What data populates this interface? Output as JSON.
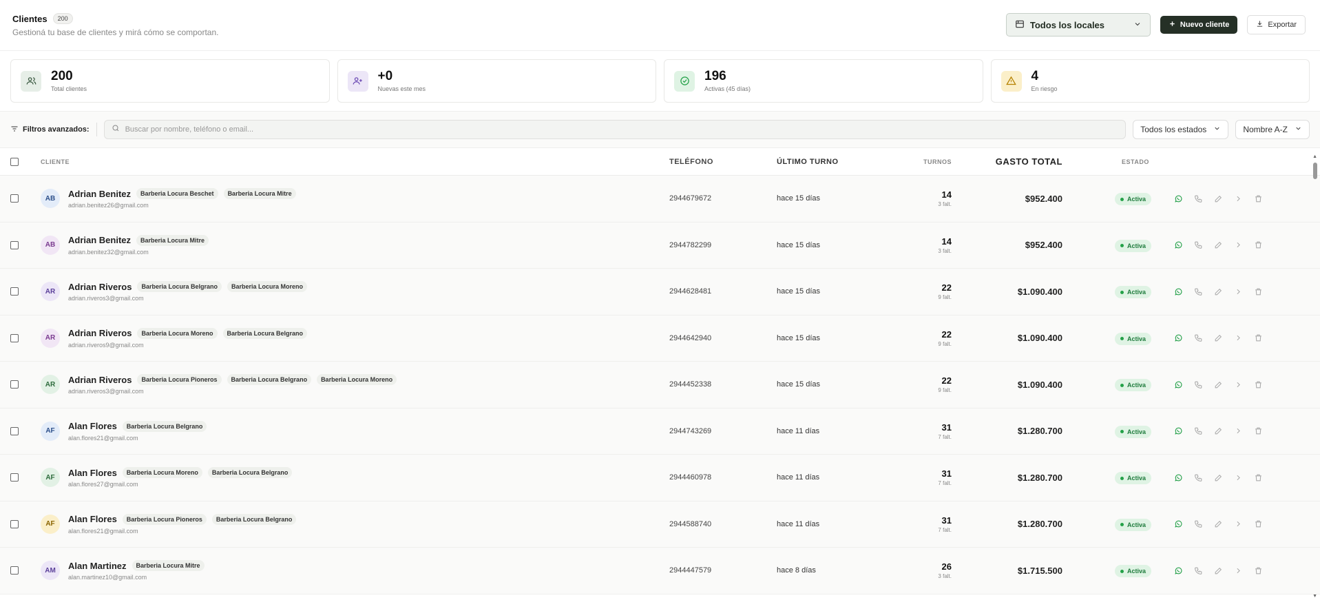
{
  "header": {
    "title": "Clientes",
    "count": "200",
    "subtitle": "Gestioná tu base de clientes y mirá cómo se comportan.",
    "locale_select": "Todos los locales",
    "new_client": "Nuevo cliente",
    "export": "Exportar"
  },
  "stats": [
    {
      "value": "200",
      "label": "Total clientes",
      "icon": "users-icon",
      "color": "#e6eee7",
      "fg": "#3c5a42"
    },
    {
      "value": "+0",
      "label": "Nuevas este mes",
      "icon": "user-plus-icon",
      "color": "#ece6f7",
      "fg": "#6c4bb4"
    },
    {
      "value": "196",
      "label": "Activas (45 días)",
      "icon": "check-circle-icon",
      "color": "#dff3e4",
      "fg": "#24a148"
    },
    {
      "value": "4",
      "label": "En riesgo",
      "icon": "warning-icon",
      "color": "#fbefc9",
      "fg": "#b58100"
    }
  ],
  "filters": {
    "label": "Filtros avanzados:",
    "search_placeholder": "Buscar por nombre, teléfono o email...",
    "status_select": "Todos los estados",
    "sort_select": "Nombre A-Z"
  },
  "table": {
    "headers": {
      "client": "CLIENTE",
      "phone": "TELÉFONO",
      "last": "ÚLTIMO TURNO",
      "turns": "TURNOS",
      "spend": "GASTO TOTAL",
      "status": "ESTADO"
    },
    "rows": [
      {
        "initials": "AB",
        "name": "Adrian Benitez",
        "tags": [
          "Barberia Locura Beschet",
          "Barberia Locura Mitre"
        ],
        "email": "adrian.benitez26@gmail.com",
        "phone": "2944679672",
        "last": "hace 15 días",
        "turns": "14",
        "missed": "3 falt.",
        "spend": "$952.400",
        "status": "Activa",
        "avatar_bg": "#e3ecf9",
        "avatar_fg": "#2c4f8a"
      },
      {
        "initials": "AB",
        "name": "Adrian Benitez",
        "tags": [
          "Barberia Locura Mitre"
        ],
        "email": "adrian.benitez32@gmail.com",
        "phone": "2944782299",
        "last": "hace 15 días",
        "turns": "14",
        "missed": "3 falt.",
        "spend": "$952.400",
        "status": "Activa",
        "avatar_bg": "#f1e6f5",
        "avatar_fg": "#7a3a8f"
      },
      {
        "initials": "AR",
        "name": "Adrian Riveros",
        "tags": [
          "Barberia Locura Belgrano",
          "Barberia Locura Moreno"
        ],
        "email": "adrian.riveros3@gmail.com",
        "phone": "2944628481",
        "last": "hace 15 días",
        "turns": "22",
        "missed": "9 falt.",
        "spend": "$1.090.400",
        "status": "Activa",
        "avatar_bg": "#ece6f7",
        "avatar_fg": "#5a3f99"
      },
      {
        "initials": "AR",
        "name": "Adrian Riveros",
        "tags": [
          "Barberia Locura Moreno",
          "Barberia Locura Belgrano"
        ],
        "email": "adrian.riveros9@gmail.com",
        "phone": "2944642940",
        "last": "hace 15 días",
        "turns": "22",
        "missed": "9 falt.",
        "spend": "$1.090.400",
        "status": "Activa",
        "avatar_bg": "#f1e6f5",
        "avatar_fg": "#7a3a8f"
      },
      {
        "initials": "AR",
        "name": "Adrian Riveros",
        "tags": [
          "Barberia Locura Pioneros",
          "Barberia Locura Belgrano",
          "Barberia Locura Moreno"
        ],
        "email": "adrian.riveros3@gmail.com",
        "phone": "2944452338",
        "last": "hace 15 días",
        "turns": "22",
        "missed": "9 falt.",
        "spend": "$1.090.400",
        "status": "Activa",
        "avatar_bg": "#e2f1e5",
        "avatar_fg": "#2d6b3c"
      },
      {
        "initials": "AF",
        "name": "Alan Flores",
        "tags": [
          "Barberia Locura Belgrano"
        ],
        "email": "alan.flores21@gmail.com",
        "phone": "2944743269",
        "last": "hace 11 días",
        "turns": "31",
        "missed": "7 falt.",
        "spend": "$1.280.700",
        "status": "Activa",
        "avatar_bg": "#e3ecf9",
        "avatar_fg": "#2c4f8a"
      },
      {
        "initials": "AF",
        "name": "Alan Flores",
        "tags": [
          "Barberia Locura Moreno",
          "Barberia Locura Belgrano"
        ],
        "email": "alan.flores27@gmail.com",
        "phone": "2944460978",
        "last": "hace 11 días",
        "turns": "31",
        "missed": "7 falt.",
        "spend": "$1.280.700",
        "status": "Activa",
        "avatar_bg": "#e2f1e5",
        "avatar_fg": "#2d6b3c"
      },
      {
        "initials": "AF",
        "name": "Alan Flores",
        "tags": [
          "Barberia Locura Pioneros",
          "Barberia Locura Belgrano"
        ],
        "email": "alan.flores21@gmail.com",
        "phone": "2944588740",
        "last": "hace 11 días",
        "turns": "31",
        "missed": "7 falt.",
        "spend": "$1.280.700",
        "status": "Activa",
        "avatar_bg": "#fbefc9",
        "avatar_fg": "#8a6400"
      },
      {
        "initials": "AM",
        "name": "Alan Martinez",
        "tags": [
          "Barberia Locura Mitre"
        ],
        "email": "alan.martinez10@gmail.com",
        "phone": "2944447579",
        "last": "hace 8 días",
        "turns": "26",
        "missed": "3 falt.",
        "spend": "$1.715.500",
        "status": "Activa",
        "avatar_bg": "#ece6f7",
        "avatar_fg": "#5a3f99"
      }
    ]
  }
}
